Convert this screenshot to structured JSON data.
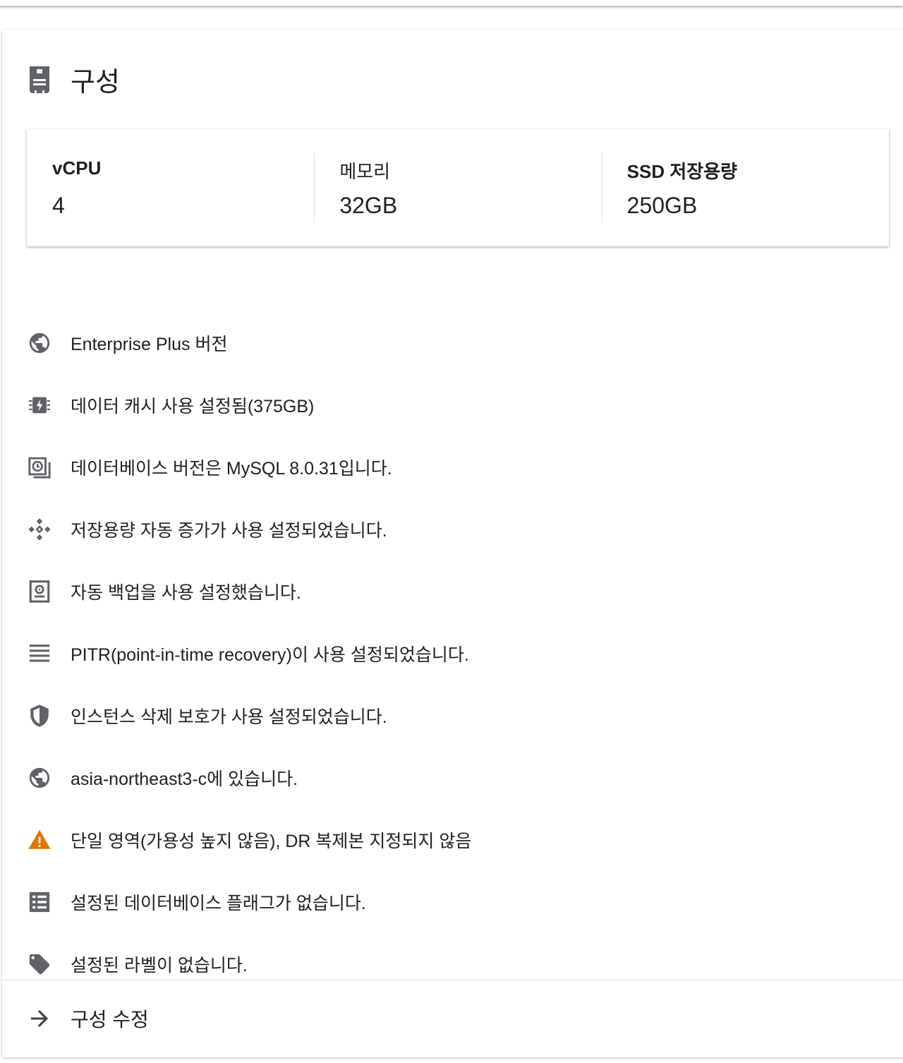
{
  "header": {
    "title": "구성",
    "icon": "server-instance-icon"
  },
  "specs": [
    {
      "label": "vCPU",
      "value": "4"
    },
    {
      "label": "메모리",
      "value": "32GB"
    },
    {
      "label": "SSD 저장용량",
      "value": "250GB"
    }
  ],
  "items": [
    {
      "icon": "globe-icon",
      "text": "Enterprise Plus 버전"
    },
    {
      "icon": "memory-chip-bolt-icon",
      "text": "데이터 캐시 사용 설정됨(375GB)"
    },
    {
      "icon": "database-version-icon",
      "text": "데이터베이스 버전은 MySQL 8.0.31입니다."
    },
    {
      "icon": "storage-autoscale-icon",
      "text": "저장용량 자동 증가가 사용 설정되었습니다."
    },
    {
      "icon": "backup-icon",
      "text": "자동 백업을 사용 설정했습니다."
    },
    {
      "icon": "log-lines-icon",
      "text": "PITR(point-in-time recovery)이 사용 설정되었습니다."
    },
    {
      "icon": "shield-icon",
      "text": "인스턴스 삭제 보호가 사용 설정되었습니다."
    },
    {
      "icon": "globe-icon",
      "text": "asia-northeast3-c에 있습니다."
    },
    {
      "icon": "warning-icon",
      "text": "단일 영역(가용성 높지 않음), DR 복제본 지정되지 않음"
    },
    {
      "icon": "list-table-icon",
      "text": "설정된 데이터베이스 플래그가 없습니다."
    },
    {
      "icon": "tag-icon",
      "text": "설정된 라벨이 없습니다."
    }
  ],
  "footer": {
    "edit_label": "구성 수정",
    "icon": "arrow-right-icon"
  },
  "colors": {
    "icon": "#5f6368",
    "warning": "#e37400",
    "text": "#202124"
  }
}
